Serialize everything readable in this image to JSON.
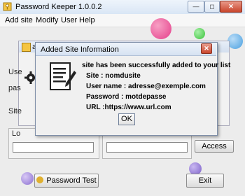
{
  "window": {
    "title": "Password Keeper 1.0.0.2",
    "buttons": {
      "minimize": "—",
      "restore": "◻",
      "close": "✕"
    }
  },
  "menu": [
    "Add site",
    "Modify",
    "User",
    "Help"
  ],
  "background": {
    "inner_title": "ad",
    "labels": {
      "user": "Use",
      "password": "pas",
      "site": "Site",
      "login": "Lo"
    },
    "access_button": "Access",
    "password_test_button": "Password Test",
    "exit_button": "Exit"
  },
  "dialog": {
    "title": "Added Site Information",
    "close": "✕",
    "lines": [
      "site has been successfully added to your list",
      "Site : nomdusite",
      "User name : adresse@exemple.com",
      "Password : motdepasse",
      "URL :https://www.url.com"
    ],
    "ok_label": "OK"
  },
  "colors": {
    "accent_purple": "#7b5fc8",
    "accent_green": "#3ac23a",
    "accent_pink": "#e53e8a",
    "accent_blue": "#4aa0e0"
  }
}
